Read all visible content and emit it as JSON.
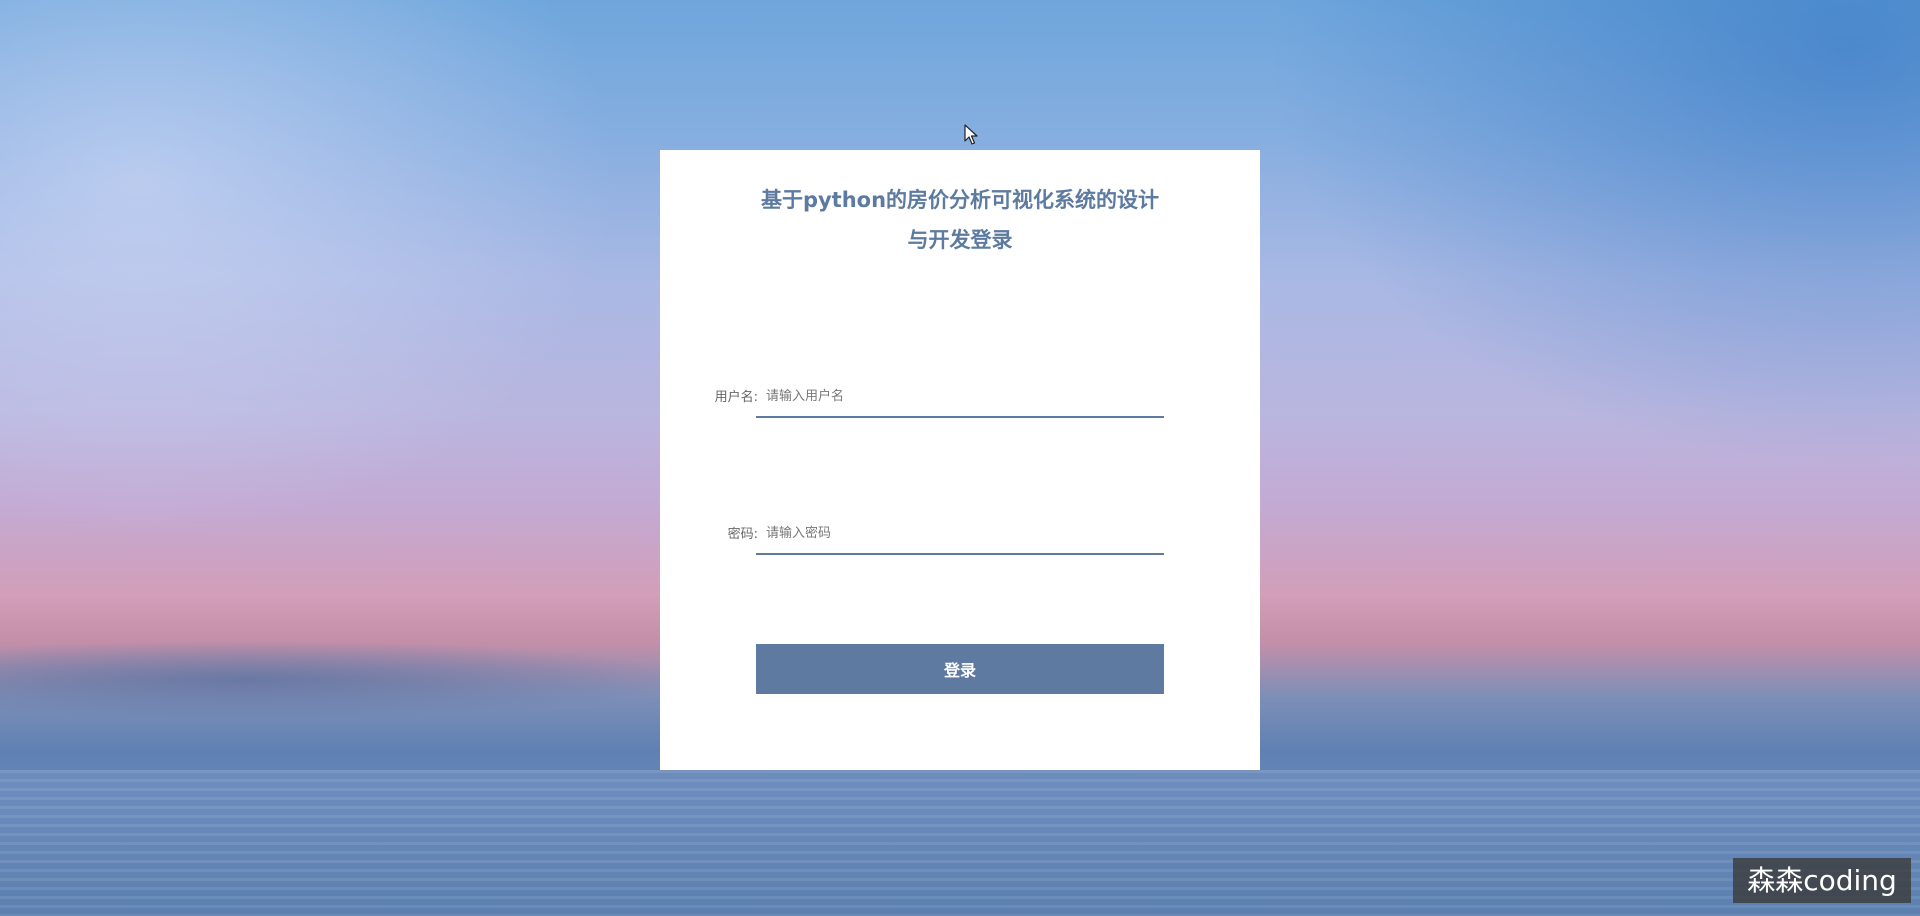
{
  "login": {
    "title": "基于python的房价分析可视化系统的设计与开发登录",
    "username": {
      "label": "用户名:",
      "placeholder": "请输入用户名",
      "value": ""
    },
    "password": {
      "label": "密码:",
      "placeholder": "请输入密码",
      "value": ""
    },
    "submit_label": "登录"
  },
  "watermark": {
    "text": "森森coding"
  },
  "colors": {
    "accent": "#5f7aa0",
    "card": "#ffffff",
    "title": "#5d7aa0"
  },
  "icons": {
    "cursor": "mouse-pointer-icon"
  }
}
